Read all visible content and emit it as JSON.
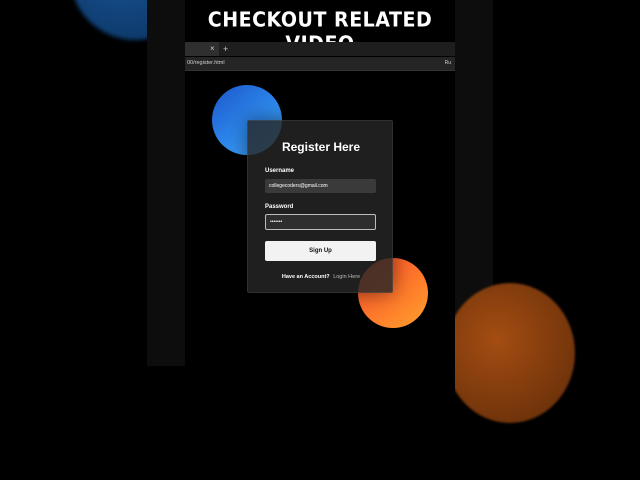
{
  "caption": "CHECKOUT RELATED VIDEO",
  "browser": {
    "tab_close_glyph": "×",
    "new_tab_glyph": "+",
    "url": "00/register.html",
    "url_right": "Ru"
  },
  "form": {
    "title": "Register Here",
    "username_label": "Username",
    "username_value": "collegecoders@gmail.com",
    "password_label": "Password",
    "password_value": "•••••••",
    "signup_label": "Sign Up",
    "have_account_text": "Have an Account?",
    "login_link_text": "Login Here"
  },
  "colors": {
    "blue_accent": "#2f8df0",
    "orange_accent": "#ff7a2b",
    "card_bg": "#262626",
    "button_bg": "#f2f2f2"
  },
  "icons": {
    "tab_close": "close-icon",
    "new_tab": "plus-icon"
  }
}
